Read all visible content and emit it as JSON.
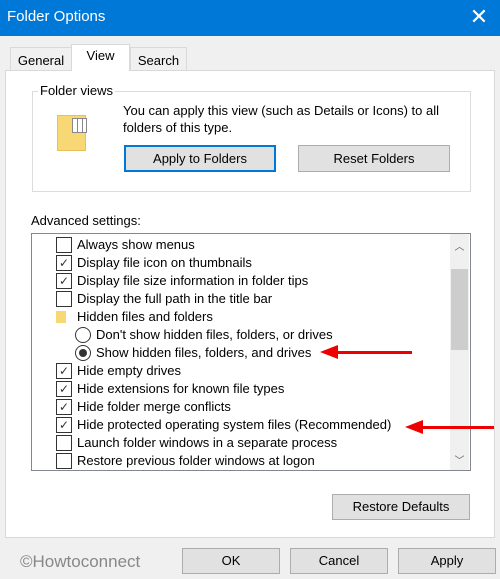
{
  "window": {
    "title": "Folder Options",
    "close_icon": "close-icon"
  },
  "tabs": [
    {
      "label": "General"
    },
    {
      "label": "View",
      "active": true
    },
    {
      "label": "Search"
    }
  ],
  "folder_views": {
    "label": "Folder views",
    "description_line1": "You can apply this view (such as Details or Icons) to all",
    "description_line2": "folders of this type.",
    "apply_button": "Apply to Folders",
    "reset_button": "Reset Folders"
  },
  "advanced": {
    "label": "Advanced settings:",
    "items": [
      {
        "type": "checkbox",
        "label": "Always show menus",
        "checked": false
      },
      {
        "type": "checkbox",
        "label": "Display file icon on thumbnails",
        "checked": true
      },
      {
        "type": "checkbox",
        "label": "Display file size information in folder tips",
        "checked": true
      },
      {
        "type": "checkbox",
        "label": "Display the full path in the title bar",
        "checked": false
      },
      {
        "type": "folder",
        "label": "Hidden files and folders"
      },
      {
        "type": "radio",
        "label": "Don't show hidden files, folders, or drives",
        "checked": false
      },
      {
        "type": "radio",
        "label": "Show hidden files, folders, and drives",
        "checked": true
      },
      {
        "type": "checkbox",
        "label": "Hide empty drives",
        "checked": true
      },
      {
        "type": "checkbox",
        "label": "Hide extensions for known file types",
        "checked": true
      },
      {
        "type": "checkbox",
        "label": "Hide folder merge conflicts",
        "checked": true
      },
      {
        "type": "checkbox",
        "label": "Hide protected operating system files (Recommended)",
        "checked": true
      },
      {
        "type": "checkbox",
        "label": "Launch folder windows in a separate process",
        "checked": false
      },
      {
        "type": "checkbox",
        "label": "Restore previous folder windows at logon",
        "checked": false
      }
    ],
    "restore_defaults": "Restore Defaults"
  },
  "footer": {
    "watermark": "©Howtoconnect",
    "ok": "OK",
    "cancel": "Cancel",
    "apply": "Apply"
  },
  "colors": {
    "titlebar": "#0078d7",
    "annotation_arrow": "#e00000"
  }
}
